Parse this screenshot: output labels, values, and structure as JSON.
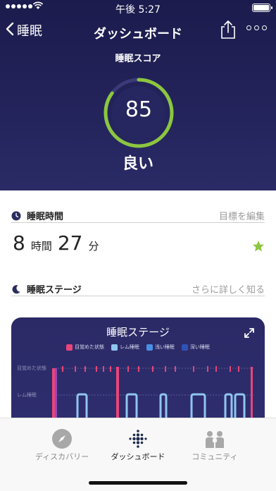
{
  "status_bar": {
    "time": "午後 5:27"
  },
  "nav": {
    "back_label": "睡眠",
    "title": "ダッシュボード"
  },
  "score": {
    "label": "睡眠スコア",
    "value": "85",
    "rating": "良い",
    "max": 100
  },
  "sleep_time": {
    "title": "睡眠時間",
    "action": "目標を編集",
    "hours": "8",
    "hours_unit": "時間",
    "minutes": "27",
    "minutes_unit": "分"
  },
  "stages": {
    "title": "睡眠ステージ",
    "action": "さらに詳しく知る",
    "card_title": "睡眠ステージ",
    "legend": [
      {
        "label": "目覚めた状態",
        "color": "#e8457a"
      },
      {
        "label": "レム睡眠",
        "color": "#8fc6ef"
      },
      {
        "label": "浅い睡眠",
        "color": "#4a8fe6"
      },
      {
        "label": "深い睡眠",
        "color": "#2d53b8"
      }
    ],
    "row_labels": {
      "awake": "目覚めた状態",
      "rem": "レム睡眠"
    }
  },
  "tabs": [
    {
      "label": "ディスカバリー",
      "icon": "compass-icon"
    },
    {
      "label": "ダッシュボード",
      "icon": "dots-grid-icon"
    },
    {
      "label": "コミュニティ",
      "icon": "people-icon"
    }
  ],
  "colors": {
    "hero_bg": "#1f1f55",
    "ring": "#8cc63f",
    "star": "#8cc63f",
    "awake": "#e8457a",
    "rem": "#8fc6ef"
  }
}
